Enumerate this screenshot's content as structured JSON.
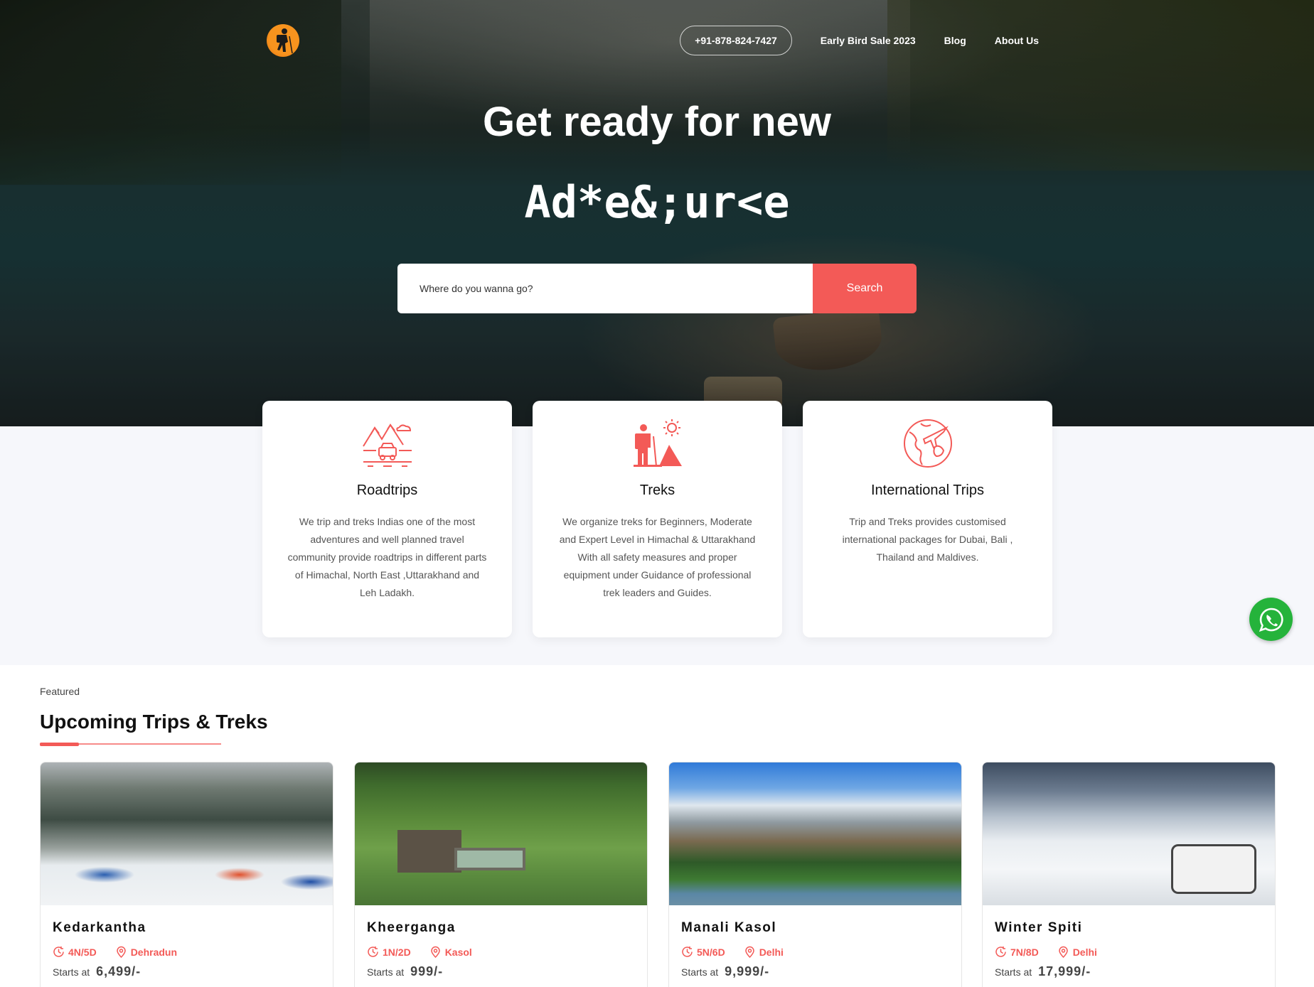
{
  "nav": {
    "phone": "+91-878-824-7427",
    "links": [
      "Early Bird Sale 2023",
      "Blog",
      "About Us"
    ]
  },
  "hero": {
    "title_line1": "Get ready for new",
    "title_line2": "Ad*e&;ur<e",
    "search_placeholder": "Where do you wanna go?",
    "search_button": "Search"
  },
  "categories": [
    {
      "icon": "roadtrip-icon",
      "title": "Roadtrips",
      "desc": "We trip and treks Indias one of the most adventures and well planned travel community provide roadtrips in different parts of Himachal, North East ,Uttarakhand and Leh Ladakh."
    },
    {
      "icon": "trekker-icon",
      "title": "Treks",
      "desc": "We organize treks for Beginners, Moderate and Expert Level in Himachal & Uttarakhand With all safety measures and proper equipment under Guidance of professional trek leaders and Guides."
    },
    {
      "icon": "globe-plane-icon",
      "title": "International Trips",
      "desc": "Trip and Treks provides customised international packages for Dubai, Bali , Thailand and Maldives."
    }
  ],
  "featured": {
    "subtitle": "Featured",
    "title": "Upcoming Trips & Treks",
    "price_label": "Starts at",
    "trips": [
      {
        "name": "Kedarkantha",
        "duration": "4N/5D",
        "location": "Dehradun",
        "price": "6,499/-"
      },
      {
        "name": "Kheerganga",
        "duration": "1N/2D",
        "location": "Kasol",
        "price": "999/-"
      },
      {
        "name": "Manali Kasol",
        "duration": "5N/6D",
        "location": "Delhi",
        "price": "9,999/-"
      },
      {
        "name": "Winter Spiti",
        "duration": "7N/8D",
        "location": "Delhi",
        "price": "17,999/-"
      }
    ]
  },
  "colors": {
    "accent": "#f35a57",
    "whatsapp": "#25b33b",
    "band_bg": "#f6f7fb"
  }
}
